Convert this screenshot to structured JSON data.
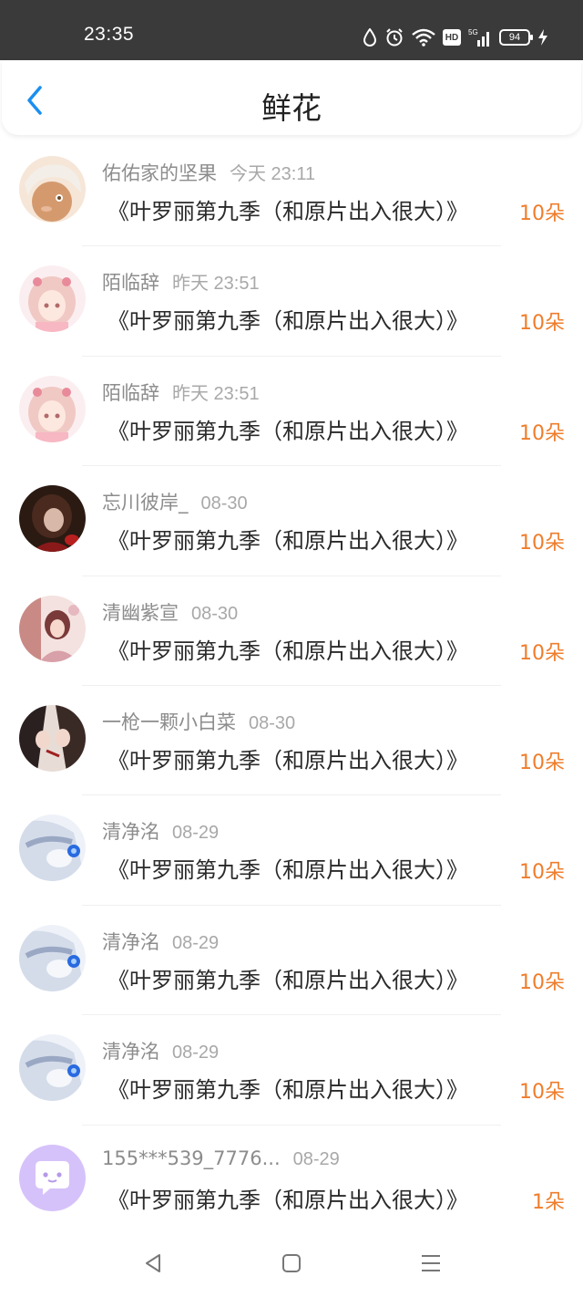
{
  "status_bar": {
    "time": "23:35",
    "hd_label": "HD",
    "network_label": "5G",
    "battery_level": "94",
    "icons": [
      "droplet-icon",
      "alarm-icon",
      "wifi-icon",
      "hd-icon",
      "signal-icon",
      "battery-icon",
      "charging-icon"
    ]
  },
  "header": {
    "title": "鲜花",
    "back_icon": "chevron-left-icon",
    "accent_color": "#1a8ff0"
  },
  "items": [
    {
      "username": "佑佑家的坚果",
      "time": "今天 23:11",
      "message": "《叶罗丽第九季（和原片出入很大）》",
      "count": "10朵"
    },
    {
      "username": "陌临辞",
      "time": "昨天 23:51",
      "message": "《叶罗丽第九季（和原片出入很大）》",
      "count": "10朵"
    },
    {
      "username": "陌临辞",
      "time": "昨天 23:51",
      "message": "《叶罗丽第九季（和原片出入很大）》",
      "count": "10朵"
    },
    {
      "username": "忘川彼岸_",
      "time": "08-30",
      "message": "《叶罗丽第九季（和原片出入很大）》",
      "count": "10朵"
    },
    {
      "username": "清幽紫宣",
      "time": "08-30",
      "message": "《叶罗丽第九季（和原片出入很大）》",
      "count": "10朵"
    },
    {
      "username": "一枪一颗小白菜",
      "time": "08-30",
      "message": "《叶罗丽第九季（和原片出入很大）》",
      "count": "10朵"
    },
    {
      "username": "清净洺",
      "time": "08-29",
      "message": "《叶罗丽第九季（和原片出入很大）》",
      "count": "10朵"
    },
    {
      "username": "清净洺",
      "time": "08-29",
      "message": "《叶罗丽第九季（和原片出入很大）》",
      "count": "10朵"
    },
    {
      "username": "清净洺",
      "time": "08-29",
      "message": "《叶罗丽第九季（和原片出入很大）》",
      "count": "10朵"
    },
    {
      "username": "155***539_7776...",
      "time": "08-29",
      "message": "《叶罗丽第九季（和原片出入很大）》",
      "count": "1朵"
    }
  ],
  "colors": {
    "count_text": "#ef7d2b",
    "username_text": "#8c8c8c",
    "status_bar_bg": "#3a3a3a"
  },
  "nav_bar": {
    "icons": [
      "back-triangle-icon",
      "home-square-icon",
      "menu-lines-icon"
    ]
  }
}
